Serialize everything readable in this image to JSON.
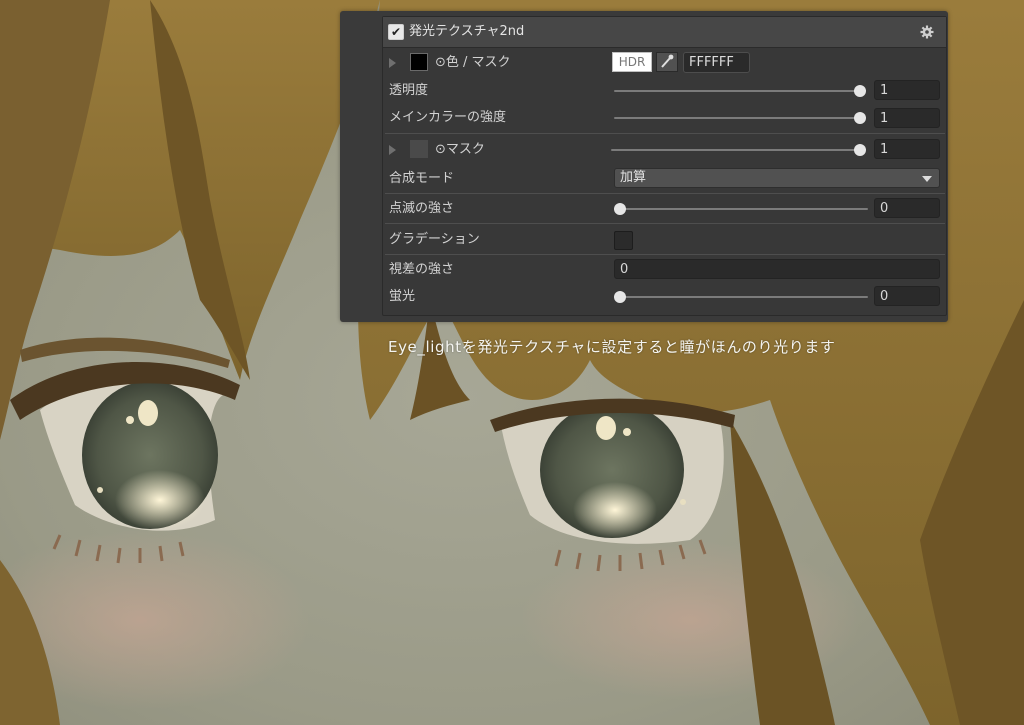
{
  "panel": {
    "section_title": "発光テクスチャ2nd",
    "section_enabled": true,
    "icons": {
      "settings": "gear-icon",
      "enable": "checkbox-icon",
      "fold": "triangle-right-icon",
      "picker": "eyedropper-icon",
      "dropdown": "chevron-down-icon"
    },
    "color_mask": {
      "label": "⊙色 / マスク",
      "hdr_label": "HDR",
      "hex_value": "FFFFFF",
      "swatch_color": "#000000"
    },
    "transparency": {
      "label": "透明度",
      "value": "1",
      "level": 1.0
    },
    "main_color_strength": {
      "label": "メインカラーの強度",
      "value": "1",
      "level": 1.0
    },
    "mask": {
      "label": "⊙マスク",
      "value": "1",
      "level": 1.0
    },
    "blend_mode": {
      "label": "合成モード",
      "selected": "加算"
    },
    "blink_strength": {
      "label": "点滅の強さ",
      "value": "0",
      "level": 0.0
    },
    "gradation": {
      "label": "グラデーション",
      "checked": false
    },
    "parallax_strength": {
      "label": "視差の強さ",
      "value": "0"
    },
    "fluorescence": {
      "label": "蛍光",
      "value": "0",
      "level": 0.0
    }
  },
  "caption": "Eye_lightを発光テクスチャに設定すると瞳がほんのり光ります",
  "colors": {
    "panel_bg": "#383838",
    "header_bg": "#474747",
    "field_bg": "#2a2a2a",
    "hair": "#8f7436",
    "iris": "#4d5346"
  }
}
